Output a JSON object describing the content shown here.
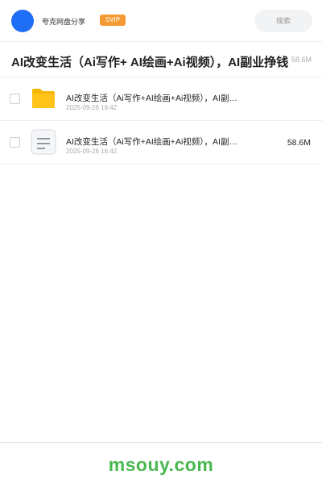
{
  "header": {
    "app_title": "夸克网盘分享",
    "badge": "SVIP",
    "search_placeholder": "搜索"
  },
  "folder": {
    "title": "AI改变生活（Ai写作+ AI绘画+Ai视频），AI副业挣钱",
    "size": "58.6M"
  },
  "files": [
    {
      "icon": "folder-icon",
      "name": "AI改变生活（Ai写作+AI绘画+Ai视频），AI副业挣钱",
      "date": "2025-09-26 16:42",
      "size": ""
    },
    {
      "icon": "document-icon",
      "name": "AI改变生活（Ai写作+AI绘画+Ai视频），AI副业挣钱",
      "date": "2025-09-26 16:42",
      "size": "58.6M"
    }
  ],
  "footer": {
    "watermark": "msouy.com"
  },
  "colors": {
    "avatar": "#1e6ff5",
    "badge": "#f39a32",
    "folder": "#ffc31a",
    "watermark": "#49b84e"
  }
}
